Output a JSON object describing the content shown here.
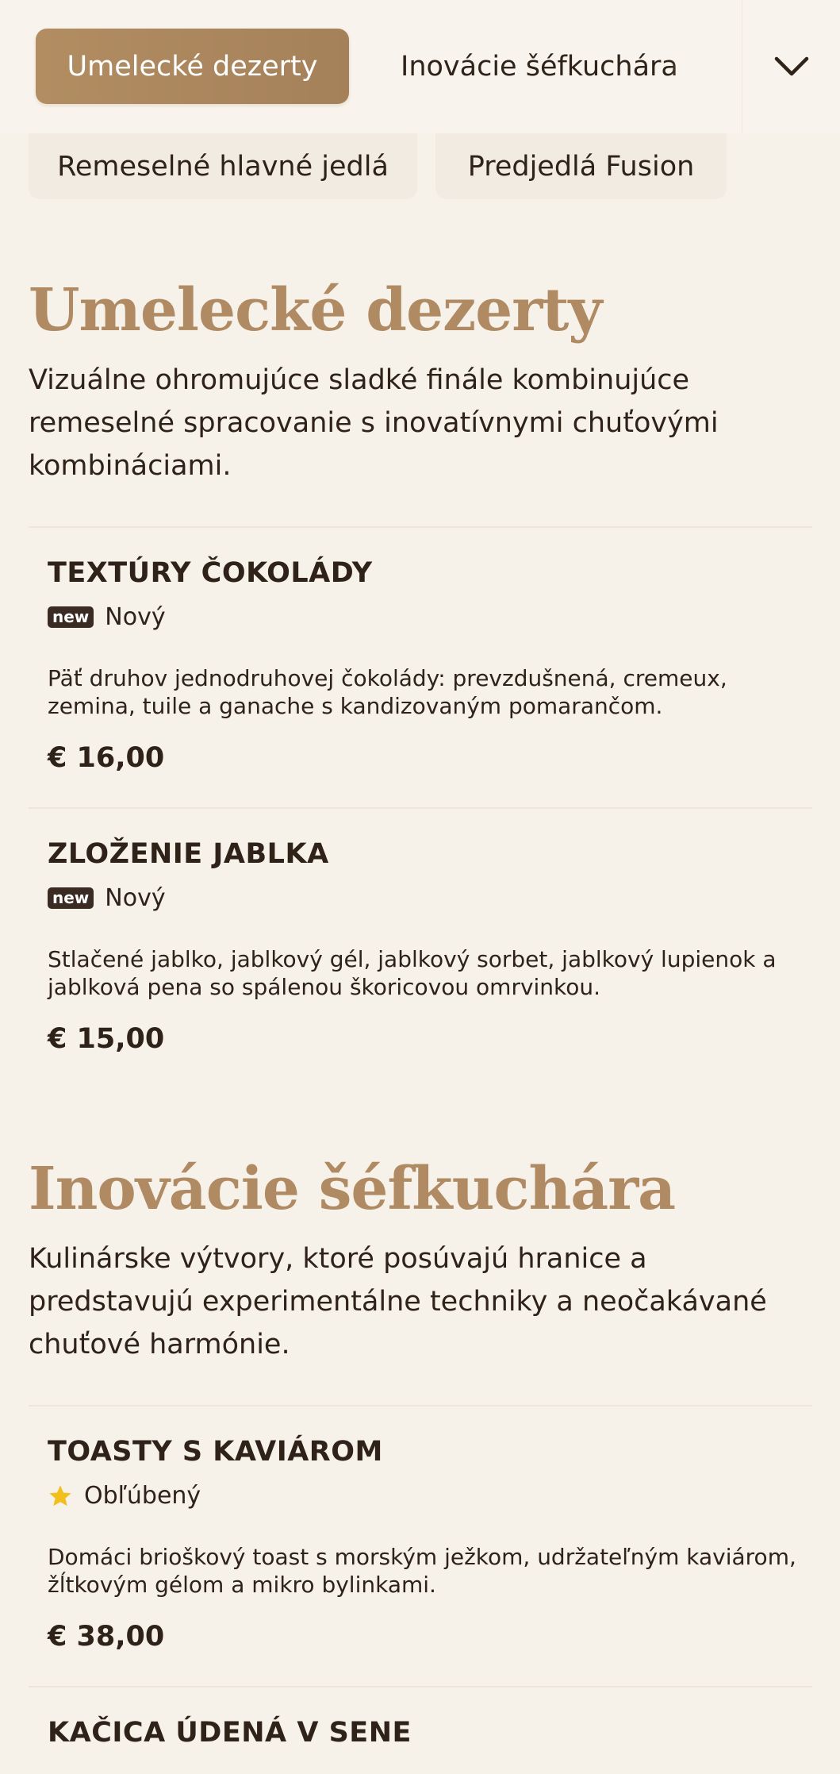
{
  "tabs": {
    "active": "Umelecké dezerty",
    "second": "Inovácie šéfkuchára",
    "third": "Remeselné hlavné jedlá",
    "fourth": "Predjedlá Fusion",
    "dropdown_icon": "chevron-down-icon"
  },
  "sections": [
    {
      "title": "Umelecké dezerty",
      "description": "Vizuálne ohromujúce sladké finále kombinujúce remeselné spracovanie s inovatívnymi chuťovými kombináciami.",
      "items": [
        {
          "name": "TEXTÚRY ČOKOLÁDY",
          "badge_icon": "new",
          "badge_label": "Nový",
          "description": "Päť druhov jednodruhovej čokolády: prevzdušnená, cremeux, zemina, tuile a ganache s kandizovaným pomarančom.",
          "price": "€ 16,00"
        },
        {
          "name": "ZLOŽENIE JABLKA",
          "badge_icon": "new",
          "badge_label": "Nový",
          "description": "Stlačené jablko, jablkový gél, jablkový sorbet, jablkový lupienok a jablková pena so spálenou škoricovou omrvinkou.",
          "price": "€ 15,00"
        }
      ]
    },
    {
      "title": "Inovácie šéfkuchára",
      "description": "Kulinárske výtvory, ktoré posúvajú hranice a predstavujú experimentálne techniky a neočakávané chuťové harmónie.",
      "items": [
        {
          "name": "TOASTY S KAVIÁROM",
          "badge_icon": "star-icon",
          "badge_label": "Obľúbený",
          "description": "Domáci brioškový toast s morským ježkom, udržateľným kaviárom, žĺtkovým gélom a mikro bylinkami.",
          "price": "€ 38,00"
        },
        {
          "name": "KAČICA ÚDENÁ V SENE"
        }
      ]
    }
  ],
  "colors": {
    "background": "#f6f1e9",
    "accent": "#b08a62",
    "text": "#2e2219",
    "star": "#f2c01d"
  }
}
